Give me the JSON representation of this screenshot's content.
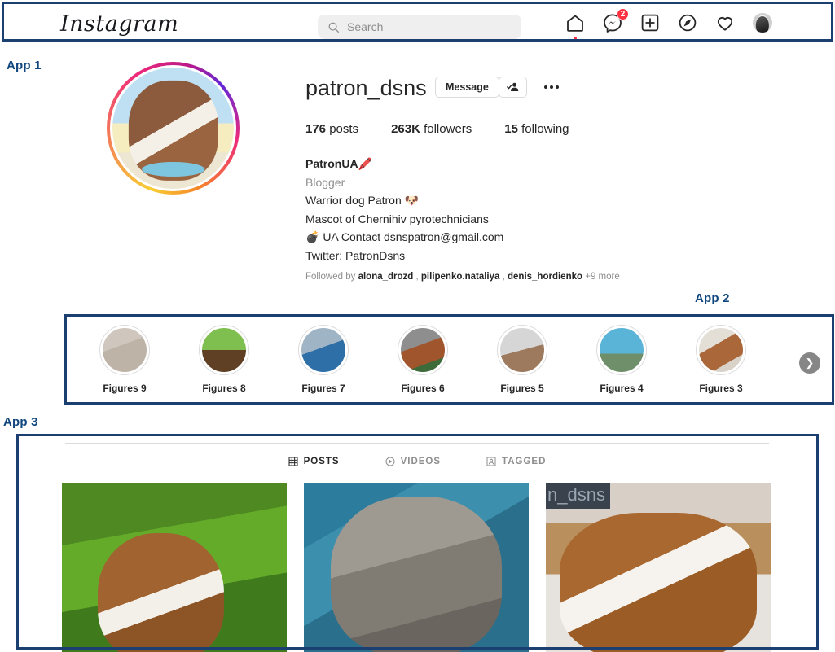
{
  "colors": {
    "annotation": "#1b3f70",
    "annotation_text": "#10477e",
    "accent_red": "#ff3040",
    "text_primary": "#262626",
    "text_secondary": "#8e8e8e"
  },
  "annotations": [
    {
      "label": "App 1"
    },
    {
      "label": "App 2"
    },
    {
      "label": "App 3"
    }
  ],
  "navbar": {
    "logo": "Instagram",
    "search": {
      "placeholder": "Search",
      "value": "",
      "icon": "search-icon"
    },
    "icons": [
      {
        "name": "home-icon",
        "label": "Home"
      },
      {
        "name": "messenger-icon",
        "label": "Messenger",
        "badge": "2"
      },
      {
        "name": "new-post-icon",
        "label": "New post"
      },
      {
        "name": "explore-icon",
        "label": "Explore"
      },
      {
        "name": "activity-heart-icon",
        "label": "Activity"
      },
      {
        "name": "profile-avatar-icon",
        "label": "Profile"
      }
    ]
  },
  "profile": {
    "username": "patron_dsns",
    "message_button": "Message",
    "follow_icon": "user-check-icon",
    "more_icon": "more-options-icon",
    "stats": [
      {
        "value": "176",
        "label": "posts"
      },
      {
        "value": "263K",
        "label": "followers"
      },
      {
        "value": "15",
        "label": "following"
      }
    ],
    "bio": {
      "name": "PatronUA🖍️",
      "category": "Blogger",
      "lines": [
        "Warrior dog Patron 🐶",
        "Mascot of Chernihiv pyrotechnicians",
        "💣 UA Contact dsnspatron@gmail.com",
        "Twitter: PatronDsns"
      ]
    },
    "followed_by": {
      "prefix": "Followed by",
      "names": [
        "alona_drozd",
        "pilipenko.nataliya",
        "denis_hordienko"
      ],
      "more": "+9 more"
    }
  },
  "highlights": {
    "next_icon": "chevron-right-icon",
    "items": [
      {
        "label": "Figures 9"
      },
      {
        "label": "Figures 8"
      },
      {
        "label": "Figures 7"
      },
      {
        "label": "Figures 6"
      },
      {
        "label": "Figures 5"
      },
      {
        "label": "Figures 4"
      },
      {
        "label": "Figures 3"
      }
    ]
  },
  "tabs": [
    {
      "label": "POSTS",
      "icon": "grid-icon",
      "active": true
    },
    {
      "label": "VIDEOS",
      "icon": "play-circle-icon",
      "active": false
    },
    {
      "label": "TAGGED",
      "icon": "tagged-person-icon",
      "active": false
    }
  ],
  "grid": [
    {
      "alt": "dog in grass",
      "overlay": ""
    },
    {
      "alt": "grey cat close-up",
      "overlay": ""
    },
    {
      "alt": "dog lying down",
      "overlay": "n_dsns"
    }
  ]
}
